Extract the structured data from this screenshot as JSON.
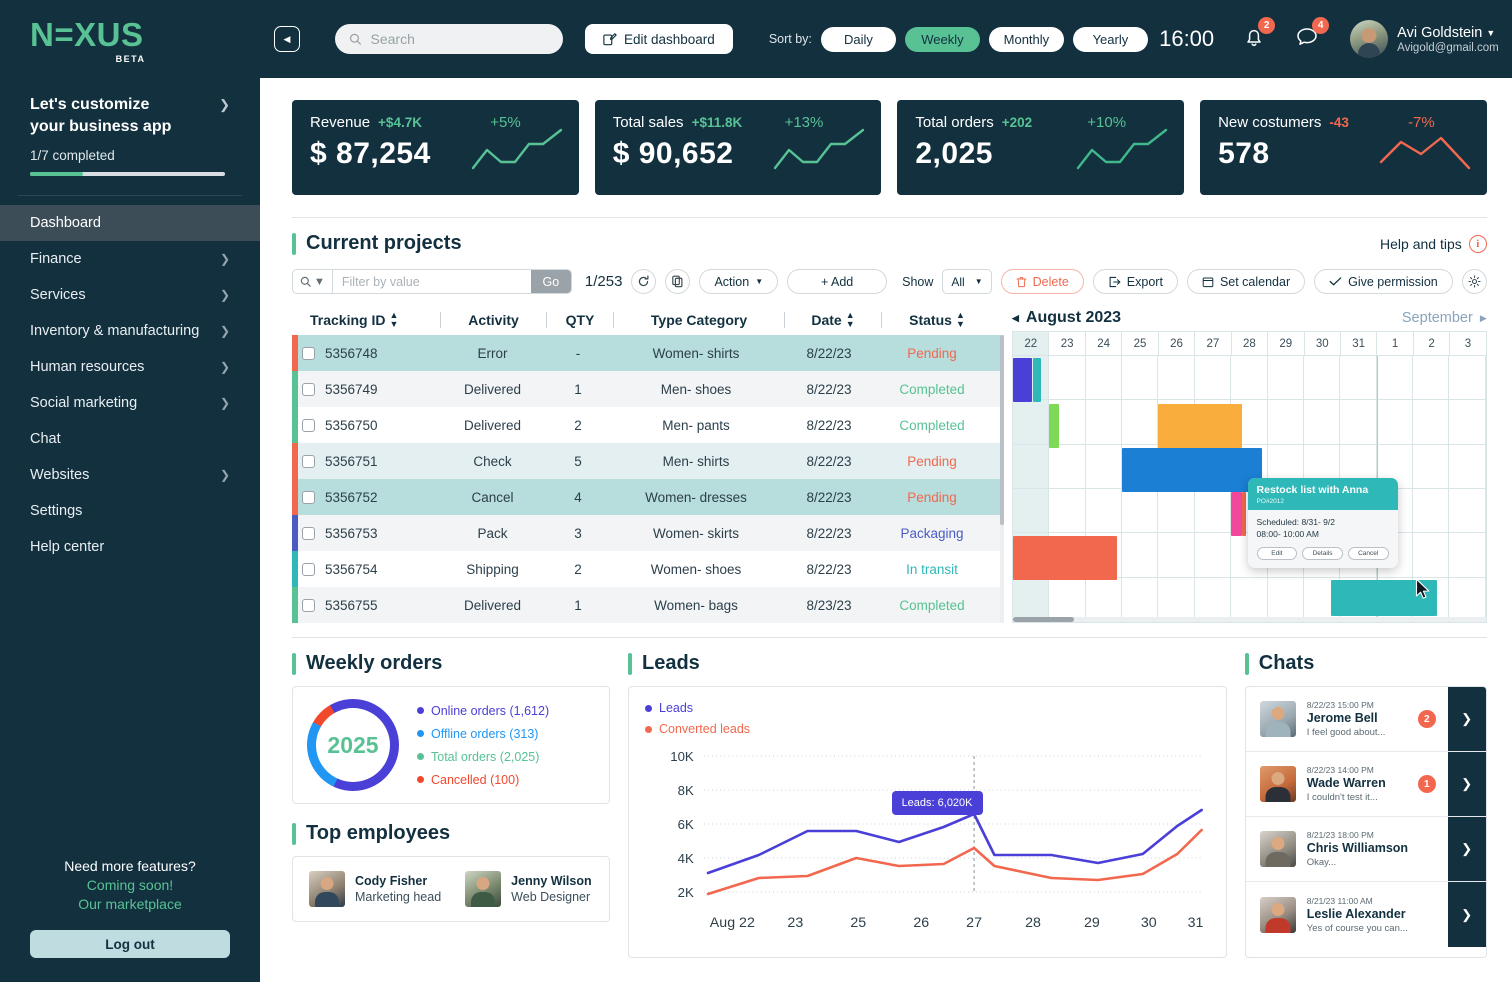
{
  "brand": {
    "name": "N=XUS",
    "name_plain": "NEXUS",
    "beta": "BETA",
    "accent": "#58c294",
    "dark": "#13303f"
  },
  "sidebar": {
    "customize_title": "Let's customize your business app",
    "customize_line1": "Let's customize",
    "customize_line2": "your business app",
    "progress_label": "1/7 completed",
    "progress_percent": 14,
    "items": [
      {
        "label": "Dashboard",
        "active": true,
        "chevron": false
      },
      {
        "label": "Finance",
        "active": false,
        "chevron": true
      },
      {
        "label": "Services",
        "active": false,
        "chevron": true
      },
      {
        "label": "Inventory & manufacturing",
        "active": false,
        "chevron": true
      },
      {
        "label": "Human resources",
        "active": false,
        "chevron": true
      },
      {
        "label": "Social marketing",
        "active": false,
        "chevron": true
      },
      {
        "label": "Chat",
        "active": false,
        "chevron": false
      },
      {
        "label": "Websites",
        "active": false,
        "chevron": true
      },
      {
        "label": "Settings",
        "active": false,
        "chevron": false
      },
      {
        "label": "Help center",
        "active": false,
        "chevron": false
      }
    ],
    "footer_question": "Need more features?",
    "footer_coming": "Coming soon!",
    "footer_market": "Our marketplace",
    "logout_label": "Log out"
  },
  "header": {
    "search_placeholder": "Search",
    "search_value": "",
    "edit_dashboard_label": "Edit dashboard",
    "sort_label": "Sort by:",
    "sort_options": [
      {
        "label": "Daily",
        "active": false
      },
      {
        "label": "Weekly",
        "active": true
      },
      {
        "label": "Monthly",
        "active": false
      },
      {
        "label": "Yearly",
        "active": false
      }
    ],
    "time": "16:00",
    "notifications_count": "2",
    "messages_count": "4",
    "user_name": "Avi Goldstein",
    "user_email": "Avigold@gmail.com"
  },
  "kpis": [
    {
      "name": "Revenue",
      "delta": "+$4.7K",
      "value": "$ 87,254",
      "pct": "+5%",
      "positive": true
    },
    {
      "name": "Total sales",
      "delta": "+$11.8K",
      "value": "$ 90,652",
      "pct": "+13%",
      "positive": true
    },
    {
      "name": "Total orders",
      "delta": "+202",
      "value": "2,025",
      "pct": "+10%",
      "positive": true
    },
    {
      "name": "New costumers",
      "delta": "-43",
      "value": "578",
      "pct": "-7%",
      "positive": false
    }
  ],
  "projects": {
    "title": "Current projects",
    "help_label": "Help and tips",
    "filter_placeholder": "Filter by value",
    "filter_value": "",
    "go_label": "Go",
    "page_count": "1/253",
    "action_label": "Action",
    "add_label": "+ Add",
    "show_label": "Show",
    "show_value": "All",
    "delete_label": "Delete",
    "export_label": "Export",
    "calendar_label": "Set calendar",
    "permission_label": "Give permission",
    "columns": [
      "Tracking ID",
      "Activity",
      "QTY",
      "Type Category",
      "Date",
      "Status"
    ],
    "rows": [
      {
        "id": "5356748",
        "activity": "Error",
        "qty": "-",
        "category": "Women- shirts",
        "date": "8/22/23",
        "status": "Pending",
        "status_class": "st-pending",
        "tag": "#f2684f",
        "highlight": true
      },
      {
        "id": "5356749",
        "activity": "Delivered",
        "qty": "1",
        "category": "Men- shoes",
        "date": "8/22/23",
        "status": "Completed",
        "status_class": "st-completed",
        "tag": "#58c294",
        "highlight": false
      },
      {
        "id": "5356750",
        "activity": "Delivered",
        "qty": "2",
        "category": "Men- pants",
        "date": "8/22/23",
        "status": "Completed",
        "status_class": "st-completed",
        "tag": "#58c294",
        "highlight": false
      },
      {
        "id": "5356751",
        "activity": "Check",
        "qty": "5",
        "category": "Men- shirts",
        "date": "8/22/23",
        "status": "Pending",
        "status_class": "st-pending",
        "tag": "#f2684f",
        "highlight": false
      },
      {
        "id": "5356752",
        "activity": "Cancel",
        "qty": "4",
        "category": "Women- dresses",
        "date": "8/22/23",
        "status": "Pending",
        "status_class": "st-pending",
        "tag": "#f2684f",
        "highlight": true
      },
      {
        "id": "5356753",
        "activity": "Pack",
        "qty": "3",
        "category": "Women- skirts",
        "date": "8/22/23",
        "status": "Packaging",
        "status_class": "st-packaging",
        "tag": "#4a5bc4",
        "highlight": false
      },
      {
        "id": "5356754",
        "activity": "Shipping",
        "qty": "2",
        "category": "Women- shoes",
        "date": "8/22/23",
        "status": "In transit",
        "status_class": "st-transit",
        "tag": "#2eb8b8",
        "highlight": false
      },
      {
        "id": "5356755",
        "activity": "Delivered",
        "qty": "1",
        "category": "Women- bags",
        "date": "8/23/23",
        "status": "Completed",
        "status_class": "st-completed",
        "tag": "#58c294",
        "highlight": false
      }
    ]
  },
  "gantt": {
    "month": "August 2023",
    "next_month": "September",
    "days": [
      "22",
      "23",
      "24",
      "25",
      "26",
      "27",
      "28",
      "29",
      "30",
      "31",
      "1",
      "2",
      "3"
    ],
    "bars": [
      {
        "row": 0,
        "start": 0,
        "span": 0.55,
        "color": "#4a3fd6"
      },
      {
        "row": 0,
        "start": 0.57,
        "span": 0.25,
        "color": "#2eb8b8"
      },
      {
        "row": 1,
        "start": 1.0,
        "span": 0.25,
        "color": "#7ed957"
      },
      {
        "row": 1,
        "start": 4.0,
        "span": 2.3,
        "color": "#f9ad3c"
      },
      {
        "row": 2,
        "start": 3.0,
        "span": 3.8,
        "color": "#1b7fd4"
      },
      {
        "row": 3,
        "start": 6.0,
        "span": 0.3,
        "color": "#f2489b"
      },
      {
        "row": 3,
        "start": 6.3,
        "span": 0.12,
        "color": "#f2684f"
      },
      {
        "row": 4,
        "start": 0,
        "span": 2.85,
        "color": "#f2684f"
      },
      {
        "row": 5,
        "start": 8.75,
        "span": 2.9,
        "color": "#2eb8b8"
      }
    ],
    "tooltip": {
      "title": "Restock list with Anna",
      "po": "PO#2012",
      "line1": "Scheduled: 8/31- 9/2",
      "line2": "08:00- 10:00 AM",
      "buttons": [
        "Edit",
        "Details",
        "Cancel"
      ]
    }
  },
  "weekly_orders": {
    "title": "Weekly orders",
    "center_value": "2025",
    "legend": [
      {
        "label": "Online orders  (1,612)",
        "color": "#4a3fd6"
      },
      {
        "label": "Offline orders (313)",
        "color": "#2196f3"
      },
      {
        "label": "Total orders (2,025)",
        "color": "#58c294"
      },
      {
        "label": "Cancelled (100)",
        "color": "#f2482b"
      }
    ]
  },
  "top_employees": {
    "title": "Top employees",
    "people": [
      {
        "name": "Cody Fisher",
        "role": "Marketing head"
      },
      {
        "name": "Jenny Wilson",
        "role": "Web Designer"
      }
    ]
  },
  "leads": {
    "title": "Leads",
    "tooltip": "Leads: 6,020K"
  },
  "chats": {
    "title": "Chats",
    "items": [
      {
        "time": "8/22/23 15:00 PM",
        "name": "Jerome Bell",
        "preview": "I feel good about...",
        "badge": "2"
      },
      {
        "time": "8/22/23 14:00 PM",
        "name": "Wade Warren",
        "preview": "I couldn't test it...",
        "badge": "1"
      },
      {
        "time": "8/21/23 18:00 PM",
        "name": "Chris Williamson",
        "preview": "Okay...",
        "badge": ""
      },
      {
        "time": "8/21/23 11:00 AM",
        "name": "Leslie Alexander",
        "preview": "Yes of course you can...",
        "badge": ""
      }
    ]
  },
  "chart_data": [
    {
      "type": "line",
      "title": "Leads",
      "x": [
        "Aug 22",
        "23",
        "25",
        "26",
        "27",
        "28",
        "29",
        "30",
        "31"
      ],
      "xlabel": "",
      "ylabel": "",
      "ylim": [
        2000,
        10000
      ],
      "yticks": [
        2000,
        4000,
        6000,
        8000,
        10000
      ],
      "ytick_labels": [
        "2K",
        "4K",
        "6K",
        "8K",
        "10K"
      ],
      "grid": true,
      "legend_position": "top-left",
      "annotation": "Leads: 6,020K",
      "annotation_x": "27",
      "series": [
        {
          "name": "Leads",
          "color": "#4a3fd6",
          "values": [
            3100,
            4200,
            5500,
            4800,
            6020,
            4200,
            4150,
            3900,
            7000
          ]
        },
        {
          "name": "Converted leads",
          "color": "#f2684f",
          "values": [
            2100,
            3450,
            4450,
            4100,
            4150,
            3200,
            2900,
            3400,
            5700
          ]
        }
      ]
    },
    {
      "type": "pie",
      "title": "Weekly orders",
      "center_label": "2025",
      "labels": [
        "Online orders",
        "Offline orders",
        "Total orders",
        "Cancelled"
      ],
      "values": [
        1612,
        313,
        2025,
        100
      ],
      "colors": [
        "#4a3fd6",
        "#2196f3",
        "#58c294",
        "#f2482b"
      ],
      "legend_position": "right"
    }
  ]
}
